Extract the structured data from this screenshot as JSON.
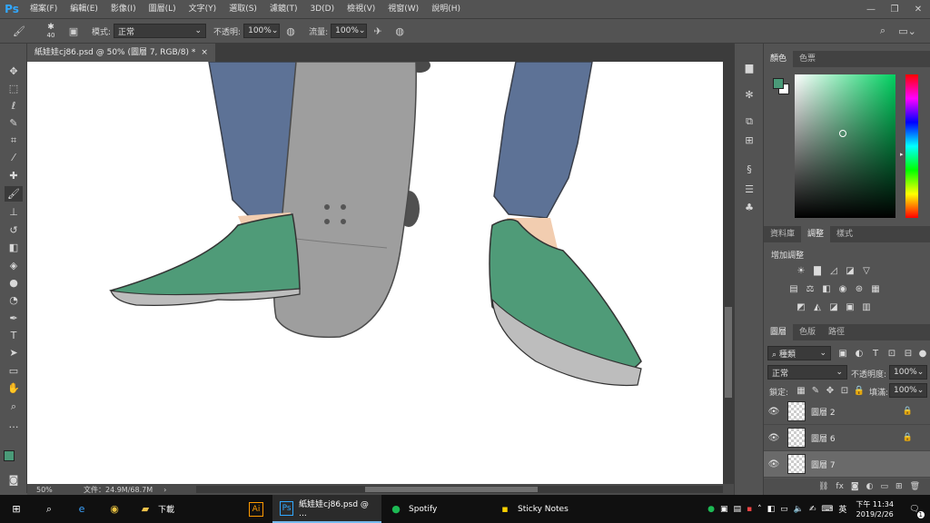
{
  "app": {
    "logo": "Ps"
  },
  "menu": [
    "檔案(F)",
    "編輯(E)",
    "影像(I)",
    "圖層(L)",
    "文字(Y)",
    "選取(S)",
    "濾鏡(T)",
    "3D(D)",
    "檢視(V)",
    "視窗(W)",
    "說明(H)"
  ],
  "window_controls": {
    "minimize": "—",
    "restore": "❐",
    "close": "✕"
  },
  "options": {
    "brush_size": "40",
    "mode_label": "模式:",
    "mode_value": "正常",
    "opacity_label": "不透明:",
    "opacity_value": "100%",
    "flow_label": "流量:",
    "flow_value": "100%"
  },
  "document": {
    "tab_title": "紙娃娃cj86.psd @ 50% (圖層 7, RGB/8) *",
    "close": "×"
  },
  "status": {
    "zoom": "50%",
    "doc_size": "文件：24.9M/68.7M"
  },
  "panels": {
    "color_tabs": [
      "顏色",
      "色票"
    ],
    "adjust_tabs": [
      "資料庫",
      "調整",
      "樣式"
    ],
    "adjust_title": "增加調整",
    "layer_tabs": [
      "圖層",
      "色版",
      "路徑"
    ],
    "filter_kind": "種類",
    "blend_mode": "正常",
    "opacity_label": "不透明度:",
    "opacity_value": "100%",
    "lock_label": "鎖定:",
    "fill_label": "填滿:",
    "fill_value": "100%",
    "layers": [
      {
        "name": "圖層 2",
        "locked": true,
        "selected": false
      },
      {
        "name": "圖層 6",
        "locked": true,
        "selected": false
      },
      {
        "name": "圖層 7",
        "locked": false,
        "selected": true
      }
    ]
  },
  "colors": {
    "foreground": "#4a9a78",
    "background": "#ffffff",
    "jeans": "#5d7296",
    "shoe": "#4f9b78",
    "board": "#9e9e9e"
  },
  "taskbar": {
    "apps": [
      {
        "label": "下載",
        "icon": "folder-icon"
      },
      {
        "label": "",
        "icon": "illustrator-icon"
      },
      {
        "label": "紙娃娃cj86.psd @ ...",
        "icon": "photoshop-icon"
      },
      {
        "label": "Spotify",
        "icon": "spotify-icon"
      },
      {
        "label": "Sticky Notes",
        "icon": "sticky-notes-icon"
      }
    ],
    "ime": "英",
    "time": "下午 11:34",
    "date": "2019/2/26",
    "notifications": "1"
  }
}
